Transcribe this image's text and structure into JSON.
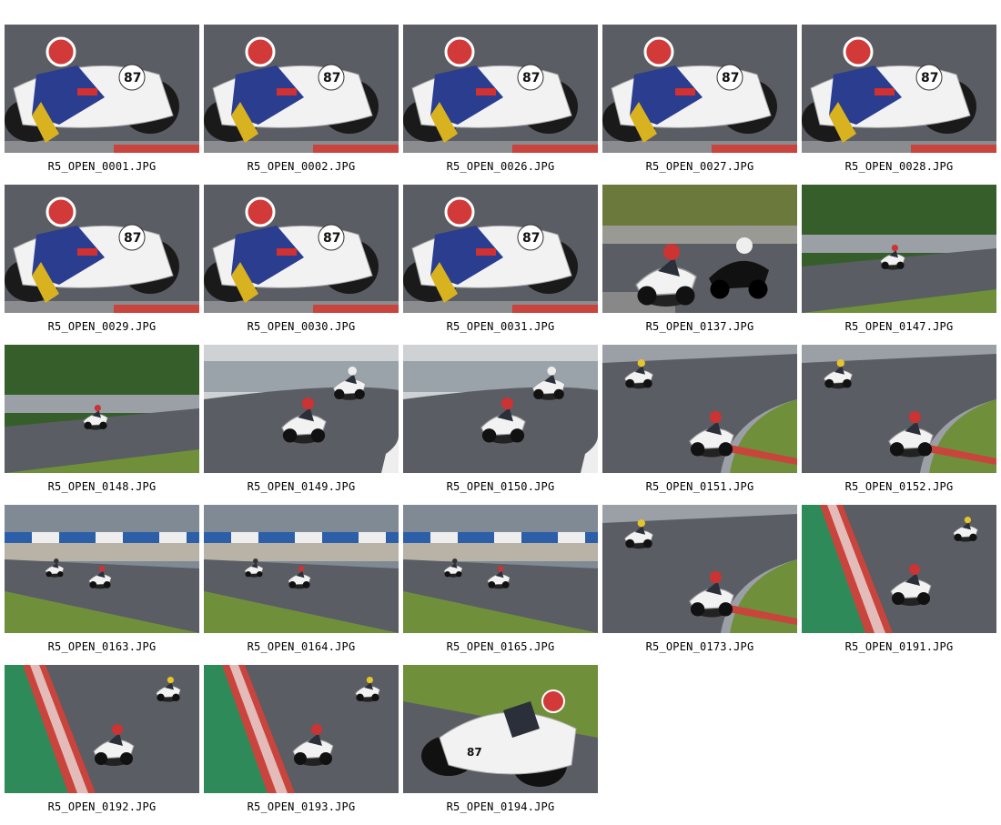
{
  "thumbnails": [
    {
      "filename": "R5_OPEN_0001.JPG",
      "scene": "closeup"
    },
    {
      "filename": "R5_OPEN_0002.JPG",
      "scene": "closeup"
    },
    {
      "filename": "R5_OPEN_0026.JPG",
      "scene": "closeup"
    },
    {
      "filename": "R5_OPEN_0027.JPG",
      "scene": "closeup"
    },
    {
      "filename": "R5_OPEN_0028.JPG",
      "scene": "closeup"
    },
    {
      "filename": "R5_OPEN_0029.JPG",
      "scene": "closeup"
    },
    {
      "filename": "R5_OPEN_0030.JPG",
      "scene": "closeup"
    },
    {
      "filename": "R5_OPEN_0031.JPG",
      "scene": "closeup"
    },
    {
      "filename": "R5_OPEN_0137.JPG",
      "scene": "pair"
    },
    {
      "filename": "R5_OPEN_0147.JPG",
      "scene": "far-trees"
    },
    {
      "filename": "R5_OPEN_0148.JPG",
      "scene": "far-trees"
    },
    {
      "filename": "R5_OPEN_0149.JPG",
      "scene": "corner"
    },
    {
      "filename": "R5_OPEN_0150.JPG",
      "scene": "corner"
    },
    {
      "filename": "R5_OPEN_0151.JPG",
      "scene": "corner-kerb"
    },
    {
      "filename": "R5_OPEN_0152.JPG",
      "scene": "corner-kerb"
    },
    {
      "filename": "R5_OPEN_0163.JPG",
      "scene": "straight-wall"
    },
    {
      "filename": "R5_OPEN_0164.JPG",
      "scene": "straight-wall"
    },
    {
      "filename": "R5_OPEN_0165.JPG",
      "scene": "straight-wall"
    },
    {
      "filename": "R5_OPEN_0173.JPG",
      "scene": "corner-kerb"
    },
    {
      "filename": "R5_OPEN_0191.JPG",
      "scene": "kerb-left"
    },
    {
      "filename": "R5_OPEN_0192.JPG",
      "scene": "kerb-left"
    },
    {
      "filename": "R5_OPEN_0193.JPG",
      "scene": "kerb-left"
    },
    {
      "filename": "R5_OPEN_0194.JPG",
      "scene": "big-bike"
    }
  ],
  "colors": {
    "asphalt": "#5a5d63",
    "grass": "#6f8f3a",
    "bike_white": "#f2f2f2",
    "kerb_red": "#c8443c",
    "helmet_red": "#d23a3a"
  }
}
